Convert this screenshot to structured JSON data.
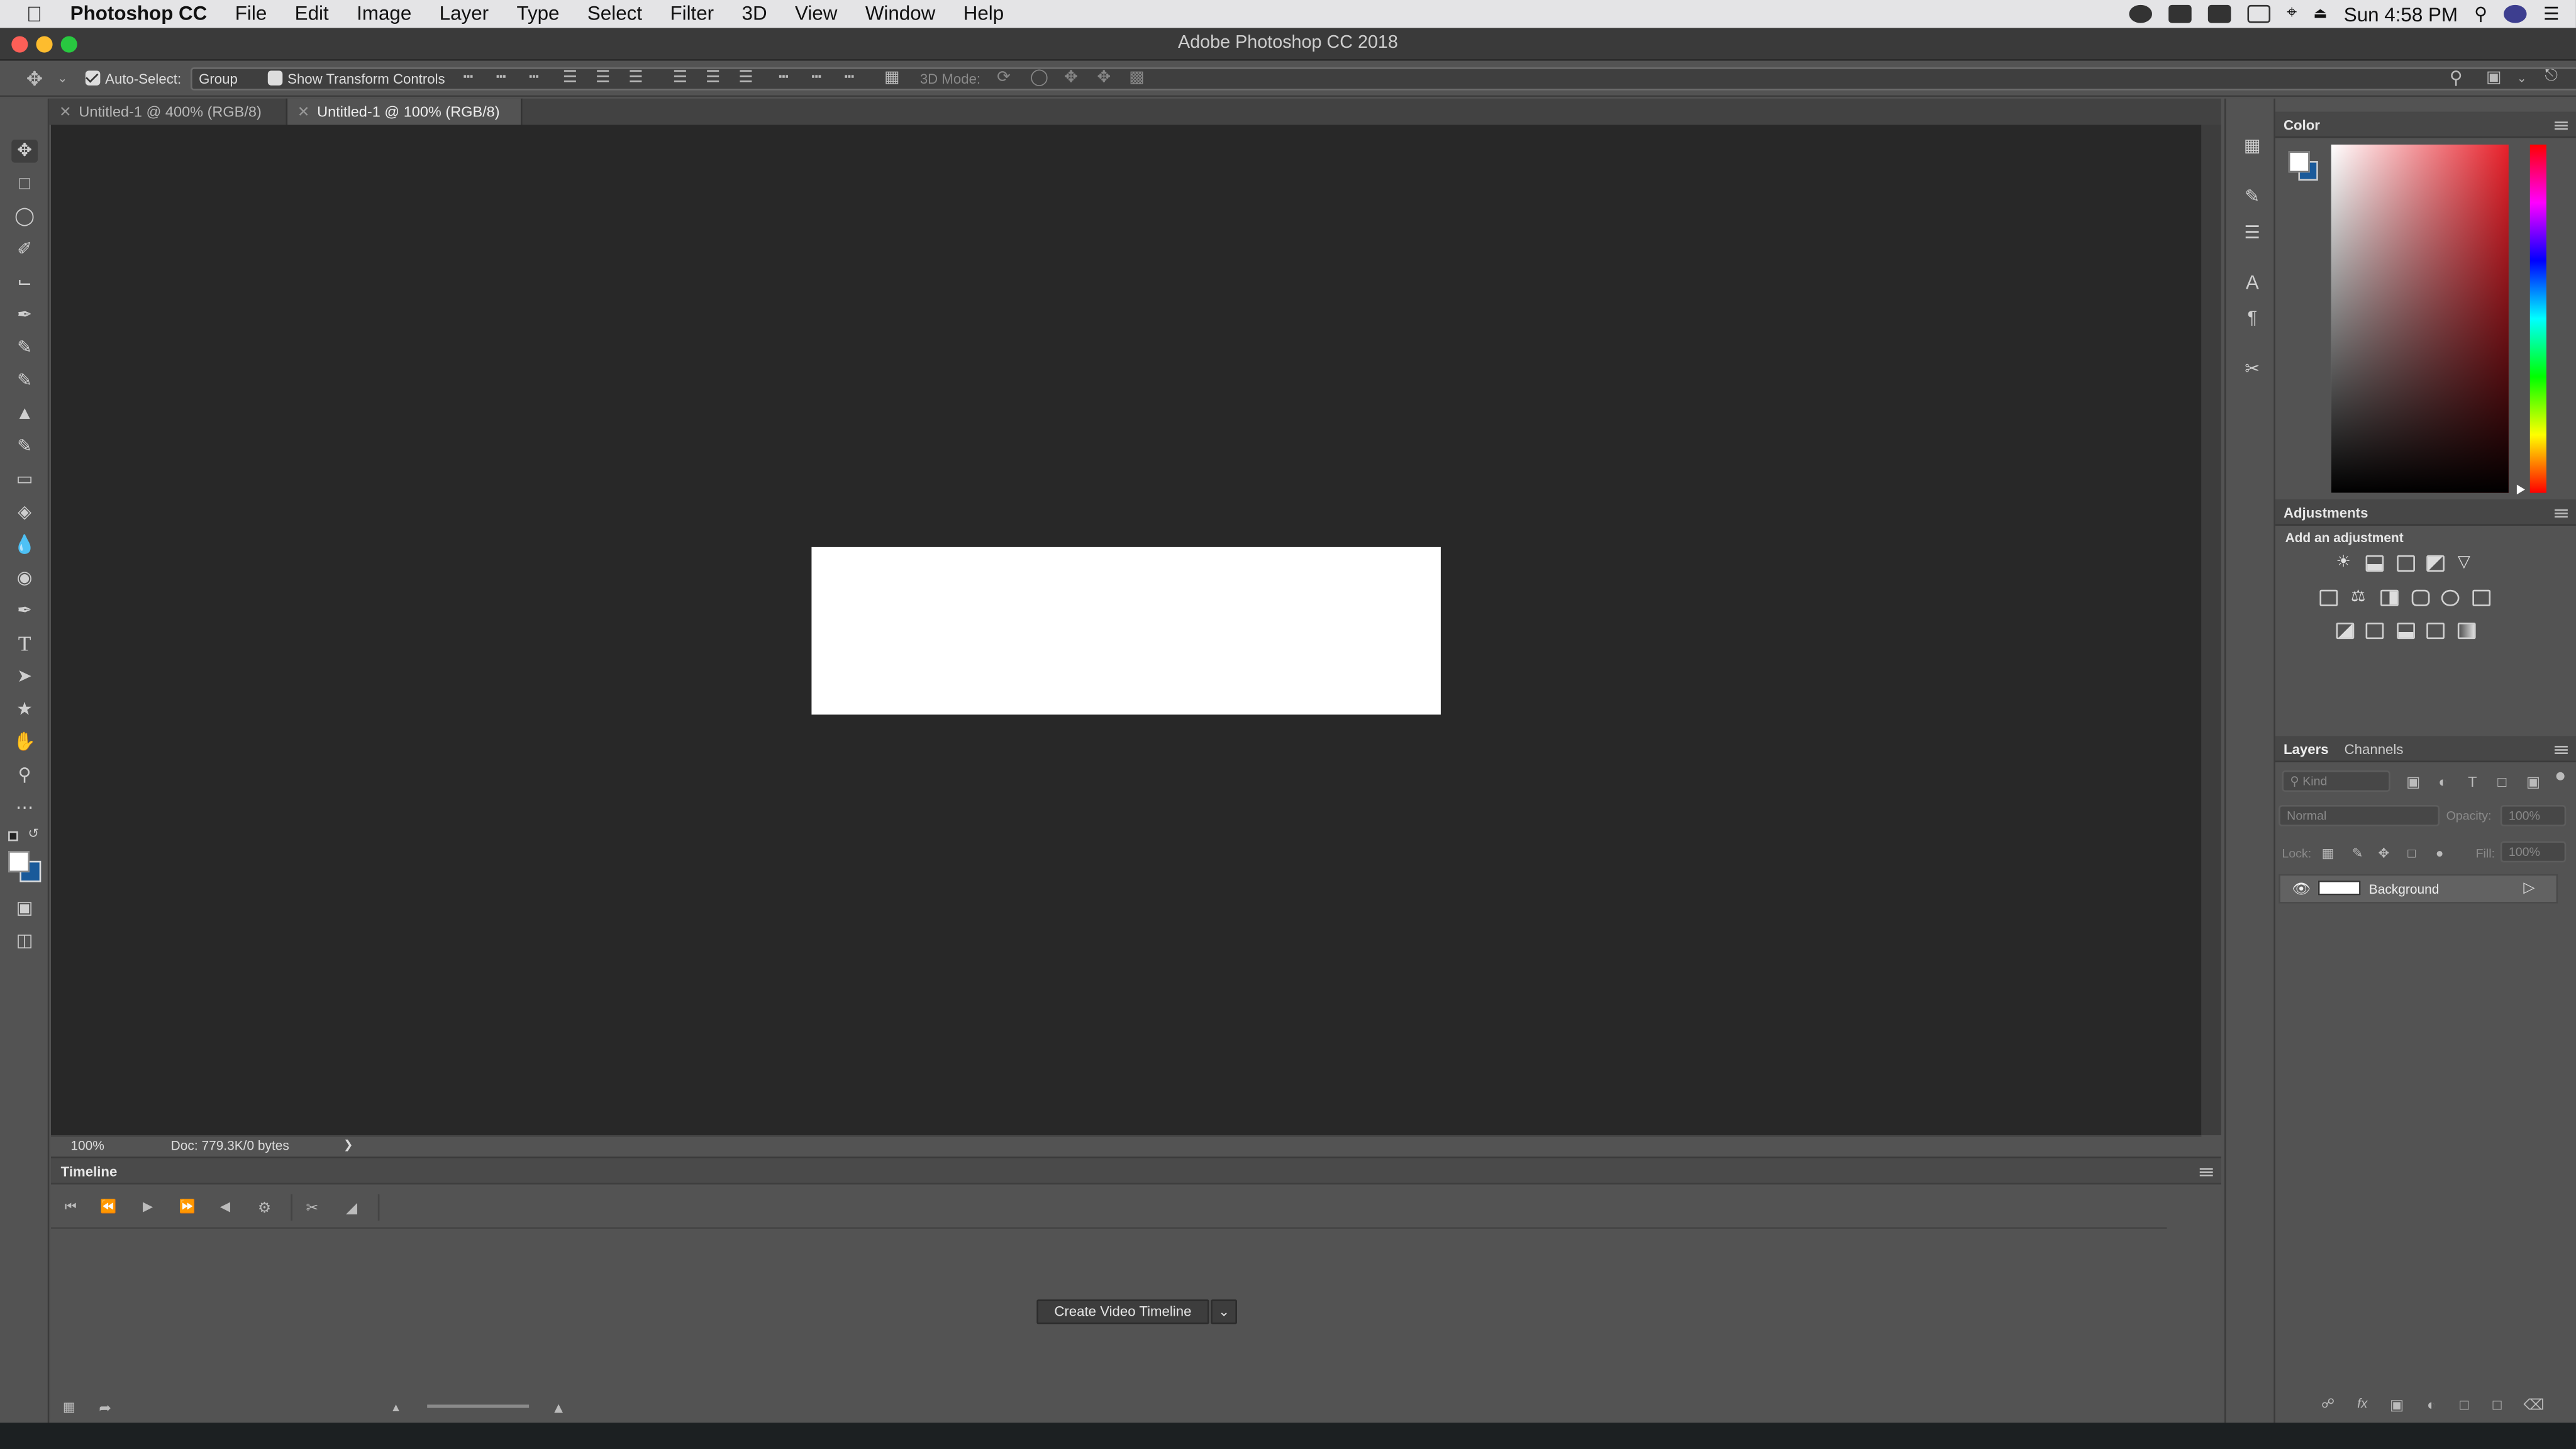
{
  "mac_menubar": {
    "app_name": "Photoshop CC",
    "menus": [
      "File",
      "Edit",
      "Image",
      "Layer",
      "Type",
      "Select",
      "Filter",
      "3D",
      "View",
      "Window",
      "Help"
    ],
    "clock": "Sun 4:58 PM"
  },
  "window": {
    "title": "Adobe Photoshop CC 2018"
  },
  "options_bar": {
    "auto_select_label": "Auto-Select:",
    "auto_select_checked": true,
    "auto_select_target": "Group",
    "show_transform_label": "Show Transform Controls",
    "mode_3d_label": "3D Mode:"
  },
  "tabs": [
    {
      "label": "Untitled-1 @ 400% (RGB/8)",
      "active": false
    },
    {
      "label": "Untitled-1 @ 100% (RGB/8)",
      "active": true
    }
  ],
  "status_bar": {
    "zoom": "100%",
    "doc_info": "Doc: 779.3K/0 bytes",
    "arrow": "❯"
  },
  "timeline": {
    "title": "Timeline",
    "create_button_label": "Create Video Timeline"
  },
  "color_panel": {
    "title": "Color",
    "foreground": "#ffffff",
    "background": "#1a5a9a"
  },
  "adjustments_panel": {
    "title": "Adjustments",
    "subtitle": "Add an adjustment"
  },
  "layers_panel": {
    "tabs": [
      "Layers",
      "Channels"
    ],
    "kind_placeholder": "Kind",
    "blend_mode": "Normal",
    "opacity_label": "Opacity:",
    "opacity_value": "100%",
    "lock_label": "Lock:",
    "fill_label": "Fill:",
    "fill_value": "100%",
    "layers": [
      {
        "name": "Background",
        "visible": true,
        "locked": true
      }
    ]
  },
  "colors": {
    "canvas_bg": "#282828",
    "ui_bg": "#535353",
    "document": "#ffffff"
  }
}
